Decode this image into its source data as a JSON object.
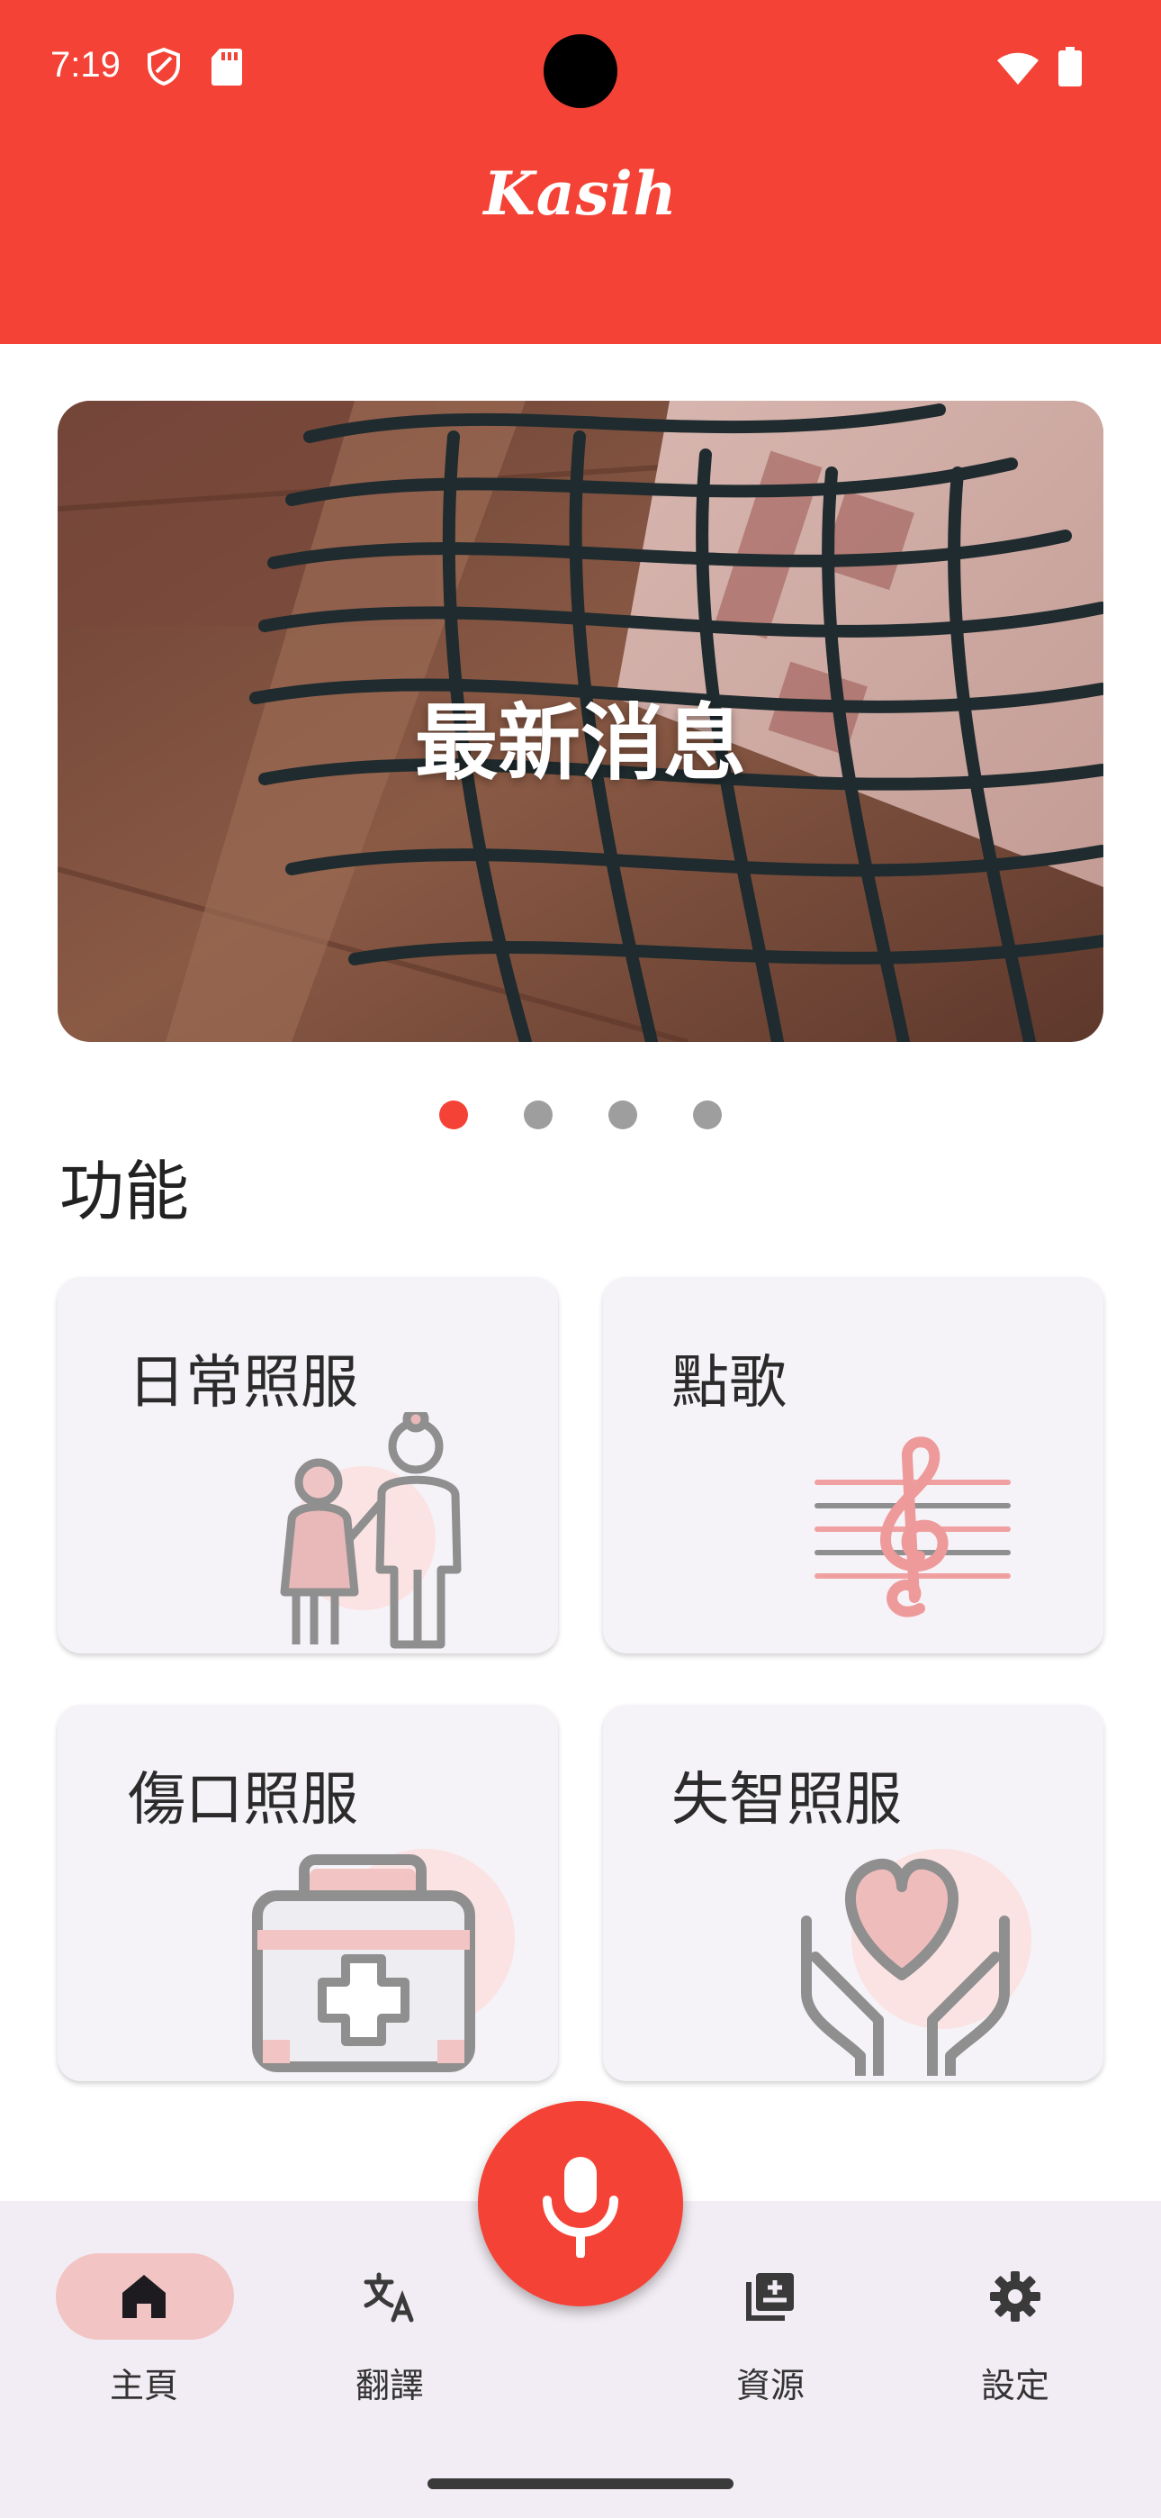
{
  "status": {
    "time": "7:19"
  },
  "app": {
    "title": "Kasih"
  },
  "banner": {
    "title": "最新消息",
    "page_count": 4,
    "active_index": 0
  },
  "section": {
    "title": "功能"
  },
  "cards": [
    {
      "label": "日常照服",
      "icon": "elderly-care-icon"
    },
    {
      "label": "點歌",
      "icon": "music-note-icon"
    },
    {
      "label": "傷口照服",
      "icon": "first-aid-kit-icon"
    },
    {
      "label": "失智照服",
      "icon": "heart-hands-icon"
    }
  ],
  "fab": {
    "icon": "microphone-icon"
  },
  "nav": {
    "items": [
      {
        "label": "主頁",
        "icon": "home-icon",
        "active": true
      },
      {
        "label": "翻譯",
        "icon": "translate-icon",
        "active": false
      },
      {
        "label": "資源",
        "icon": "library-add-icon",
        "active": false
      },
      {
        "label": "設定",
        "icon": "settings-icon",
        "active": false
      }
    ]
  },
  "colors": {
    "primary": "#f44336",
    "card_bg": "#f5f3f8",
    "nav_bg": "#f2edf4",
    "nav_active_pill": "#f2c4c4"
  }
}
